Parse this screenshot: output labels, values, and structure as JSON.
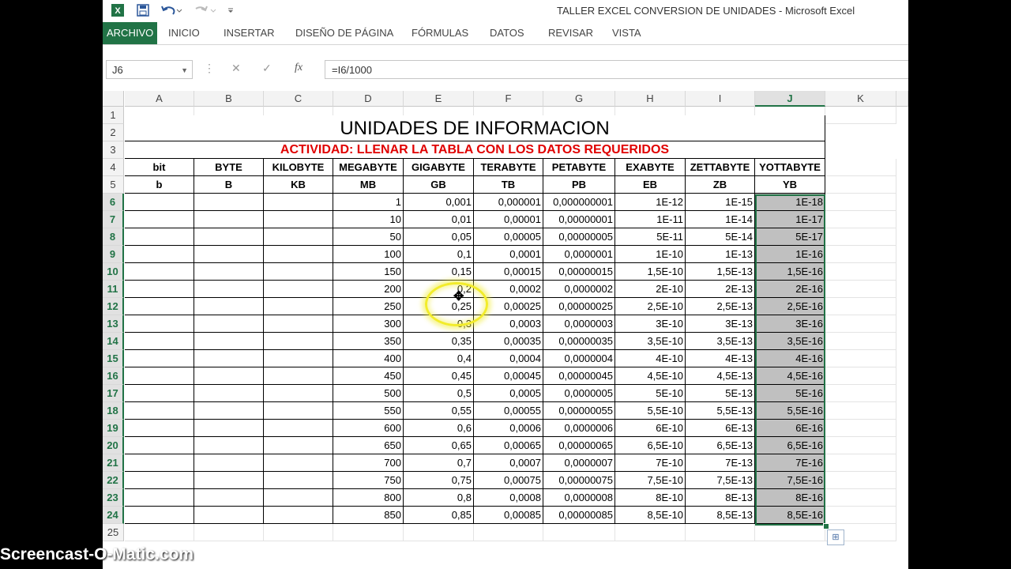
{
  "window": {
    "title": "TALLER EXCEL CONVERSION DE UNIDADES - Microsoft Excel"
  },
  "quick_access": {
    "icons": [
      "excel-logo-icon",
      "save-icon",
      "undo-icon",
      "redo-icon",
      "customize-icon"
    ]
  },
  "ribbon": {
    "tabs": [
      "ARCHIVO",
      "INICIO",
      "INSERTAR",
      "DISEÑO DE PÁGINA",
      "FÓRMULAS",
      "DATOS",
      "REVISAR",
      "VISTA"
    ]
  },
  "formula_bar": {
    "name_box": "J6",
    "formula": "=I6/1000",
    "fx": "fx"
  },
  "columns": [
    "A",
    "B",
    "C",
    "D",
    "E",
    "F",
    "G",
    "H",
    "I",
    "J",
    "K"
  ],
  "selected_column": "J",
  "sheet": {
    "title": "UNIDADES DE INFORMACION",
    "subtitle": "ACTIVIDAD: LLENAR  LA TABLA CON LOS DATOS REQUERIDOS",
    "headers": [
      "bit",
      "BYTE",
      "KILOBYTE",
      "MEGABYTE",
      "GIGABYTE",
      "TERABYTE",
      "PETABYTE",
      "EXABYTE",
      "ZETTABYTE",
      "YOTTABYTE"
    ],
    "units": [
      "b",
      "B",
      "KB",
      "MB",
      "GB",
      "TB",
      "PB",
      "EB",
      "ZB",
      "YB"
    ],
    "rows": [
      {
        "n": "6",
        "D": "1",
        "E": "0,001",
        "F": "0,000001",
        "G": "0,000000001",
        "H": "1E-12",
        "I": "1E-15",
        "J": "1E-18"
      },
      {
        "n": "7",
        "D": "10",
        "E": "0,01",
        "F": "0,00001",
        "G": "0,00000001",
        "H": "1E-11",
        "I": "1E-14",
        "J": "1E-17"
      },
      {
        "n": "8",
        "D": "50",
        "E": "0,05",
        "F": "0,00005",
        "G": "0,00000005",
        "H": "5E-11",
        "I": "5E-14",
        "J": "5E-17"
      },
      {
        "n": "9",
        "D": "100",
        "E": "0,1",
        "F": "0,0001",
        "G": "0,0000001",
        "H": "1E-10",
        "I": "1E-13",
        "J": "1E-16"
      },
      {
        "n": "10",
        "D": "150",
        "E": "0,15",
        "F": "0,00015",
        "G": "0,00000015",
        "H": "1,5E-10",
        "I": "1,5E-13",
        "J": "1,5E-16"
      },
      {
        "n": "11",
        "D": "200",
        "E": "0,2",
        "F": "0,0002",
        "G": "0,0000002",
        "H": "2E-10",
        "I": "2E-13",
        "J": "2E-16"
      },
      {
        "n": "12",
        "D": "250",
        "E": "0,25",
        "F": "0,00025",
        "G": "0,00000025",
        "H": "2,5E-10",
        "I": "2,5E-13",
        "J": "2,5E-16"
      },
      {
        "n": "13",
        "D": "300",
        "E": "0,3",
        "F": "0,0003",
        "G": "0,0000003",
        "H": "3E-10",
        "I": "3E-13",
        "J": "3E-16"
      },
      {
        "n": "14",
        "D": "350",
        "E": "0,35",
        "F": "0,00035",
        "G": "0,00000035",
        "H": "3,5E-10",
        "I": "3,5E-13",
        "J": "3,5E-16"
      },
      {
        "n": "15",
        "D": "400",
        "E": "0,4",
        "F": "0,0004",
        "G": "0,0000004",
        "H": "4E-10",
        "I": "4E-13",
        "J": "4E-16"
      },
      {
        "n": "16",
        "D": "450",
        "E": "0,45",
        "F": "0,00045",
        "G": "0,00000045",
        "H": "4,5E-10",
        "I": "4,5E-13",
        "J": "4,5E-16"
      },
      {
        "n": "17",
        "D": "500",
        "E": "0,5",
        "F": "0,0005",
        "G": "0,0000005",
        "H": "5E-10",
        "I": "5E-13",
        "J": "5E-16"
      },
      {
        "n": "18",
        "D": "550",
        "E": "0,55",
        "F": "0,00055",
        "G": "0,00000055",
        "H": "5,5E-10",
        "I": "5,5E-13",
        "J": "5,5E-16"
      },
      {
        "n": "19",
        "D": "600",
        "E": "0,6",
        "F": "0,0006",
        "G": "0,0000006",
        "H": "6E-10",
        "I": "6E-13",
        "J": "6E-16"
      },
      {
        "n": "20",
        "D": "650",
        "E": "0,65",
        "F": "0,00065",
        "G": "0,00000065",
        "H": "6,5E-10",
        "I": "6,5E-13",
        "J": "6,5E-16"
      },
      {
        "n": "21",
        "D": "700",
        "E": "0,7",
        "F": "0,0007",
        "G": "0,0000007",
        "H": "7E-10",
        "I": "7E-13",
        "J": "7E-16"
      },
      {
        "n": "22",
        "D": "750",
        "E": "0,75",
        "F": "0,00075",
        "G": "0,00000075",
        "H": "7,5E-10",
        "I": "7,5E-13",
        "J": "7,5E-16"
      },
      {
        "n": "23",
        "D": "800",
        "E": "0,8",
        "F": "0,0008",
        "G": "0,0000008",
        "H": "8E-10",
        "I": "8E-13",
        "J": "8E-16"
      },
      {
        "n": "24",
        "D": "850",
        "E": "0,85",
        "F": "0,00085",
        "G": "0,00000085",
        "H": "8,5E-10",
        "I": "8,5E-13",
        "J": "8,5E-16"
      }
    ],
    "row_numbers_top": [
      "1",
      "2",
      "3",
      "4",
      "5"
    ],
    "row_numbers_bottom": [
      "25"
    ]
  },
  "watermark": "Screencast-O-Matic.com",
  "colors": {
    "accent": "#217346",
    "subtitle": "#e00000",
    "selection_fill": "#c0c0c0"
  }
}
